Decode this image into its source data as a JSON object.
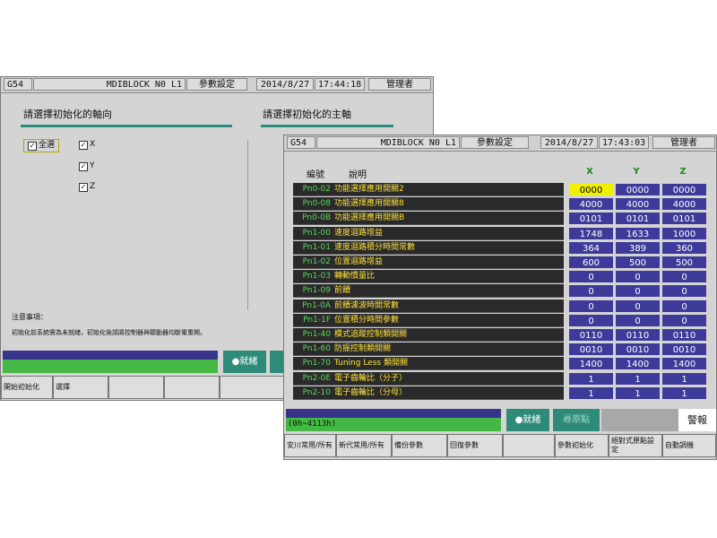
{
  "win1": {
    "status": {
      "coord": "G54",
      "program": "MDIBLOCK N0 L1",
      "mode": "參數設定",
      "date": "2014/8/27",
      "time": "17:44:18",
      "user": "管理者"
    },
    "axis_heading": "請選擇初始化的軸向",
    "spindle_heading": "請選擇初始化的主軸",
    "checkboxes": {
      "all": "全選",
      "x": "X",
      "y": "Y",
      "z": "Z"
    },
    "notes_title": "注意事項：",
    "notes_text": "初始化前系統需為未就緒，初始化後請將控制器與驅動器均斷電重開。",
    "ready_label": "●就緒",
    "softkeys": [
      "開始初始化",
      "選擇"
    ]
  },
  "win2": {
    "status": {
      "coord": "G54",
      "program": "MDIBLOCK N0 L1",
      "mode": "參數設定",
      "date": "2014/8/27",
      "time": "17:43:03",
      "user": "管理者"
    },
    "table": {
      "headers": {
        "code": "編號",
        "desc": "說明",
        "x": "X",
        "y": "Y",
        "z": "Z"
      },
      "rows": [
        {
          "code": "Pn0-02",
          "desc": "功能選擇應用開關2",
          "x": "0000",
          "y": "0000",
          "z": "0000"
        },
        {
          "code": "Pn0-08",
          "desc": "功能選擇應用開關8",
          "x": "4000",
          "y": "4000",
          "z": "4000"
        },
        {
          "code": "Pn0-0B",
          "desc": "功能選擇應用開關B",
          "x": "0101",
          "y": "0101",
          "z": "0101"
        },
        {
          "code": "Pn1-00",
          "desc": "速度迴路增益",
          "x": "1748",
          "y": "1633",
          "z": "1000"
        },
        {
          "code": "Pn1-01",
          "desc": "速度迴路積分時間常數",
          "x": "364",
          "y": "389",
          "z": "360"
        },
        {
          "code": "Pn1-02",
          "desc": "位置迴路增益",
          "x": "600",
          "y": "500",
          "z": "500"
        },
        {
          "code": "Pn1-03",
          "desc": "轉動慣量比",
          "x": "0",
          "y": "0",
          "z": "0"
        },
        {
          "code": "Pn1-09",
          "desc": "前饋",
          "x": "0",
          "y": "0",
          "z": "0"
        },
        {
          "code": "Pn1-0A",
          "desc": "前饋濾波時間常數",
          "x": "0",
          "y": "0",
          "z": "0"
        },
        {
          "code": "Pn1-1F",
          "desc": "位置積分時間參數",
          "x": "0",
          "y": "0",
          "z": "0"
        },
        {
          "code": "Pn1-40",
          "desc": "模式追蹤控制類開關",
          "x": "0110",
          "y": "0110",
          "z": "0110"
        },
        {
          "code": "Pn1-60",
          "desc": "防振控制類開關",
          "x": "0010",
          "y": "0010",
          "z": "0010"
        },
        {
          "code": "Pn1-70",
          "desc": "Tuning Less 類開關",
          "x": "1400",
          "y": "1400",
          "z": "1400"
        },
        {
          "code": "Pn2-0E",
          "desc": "電子齒輪比（分子）",
          "x": "1",
          "y": "1",
          "z": "1"
        },
        {
          "code": "Pn2-10",
          "desc": "電子齒輪比（分母）",
          "x": "1",
          "y": "1",
          "z": "1"
        }
      ]
    },
    "hint": "(0h~4113h)",
    "ready_label": "●就緒",
    "home_label": "尋原點",
    "alarm_label": "警報",
    "softkeys": [
      "安川常用/所有",
      "新代常用/所有",
      "備份參數",
      "回復參數",
      "",
      "參數初始化",
      "絕對式原點設定",
      "自動調機"
    ]
  },
  "colors": {
    "green": "#44b844",
    "navy": "#38348c",
    "teal": "#2e8b79",
    "param_blue": "#3d3a9a",
    "selected": "#f0f000"
  }
}
